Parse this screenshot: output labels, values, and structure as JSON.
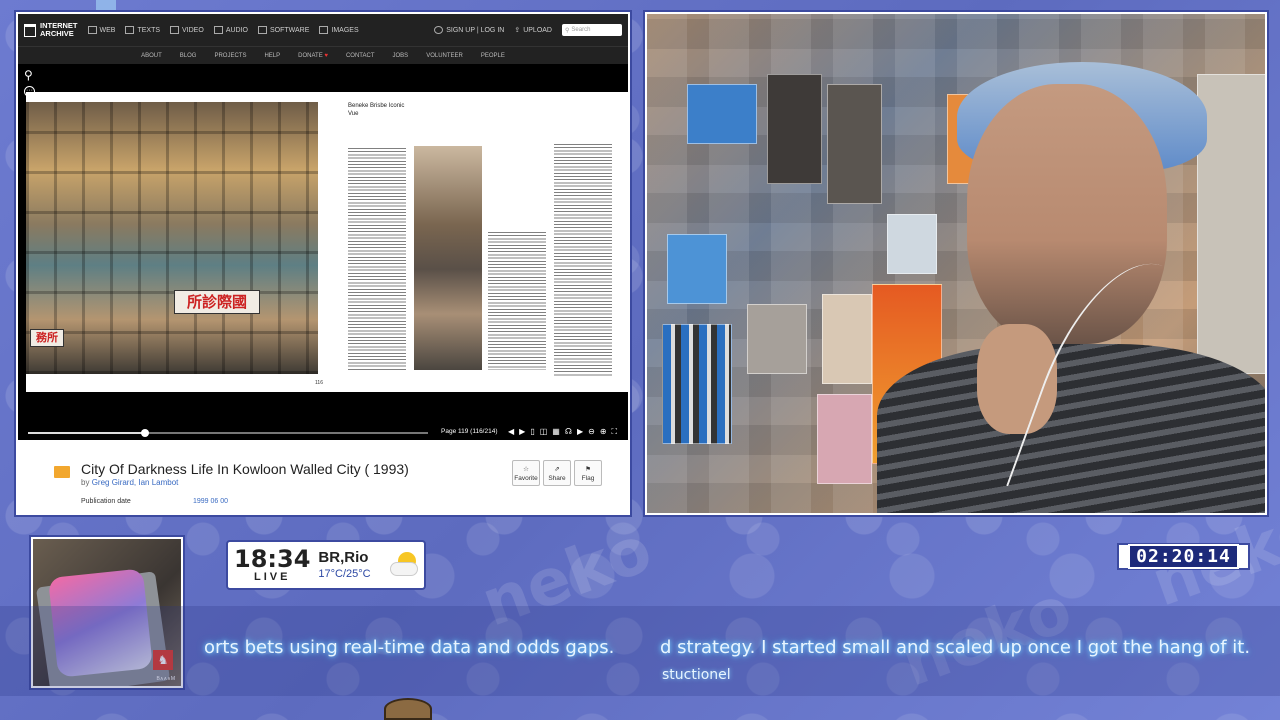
{
  "browser": {
    "logo_line1": "INTERNET",
    "logo_line2": "ARCHIVE",
    "nav": [
      "WEB",
      "TEXTS",
      "VIDEO",
      "AUDIO",
      "SOFTWARE",
      "IMAGES"
    ],
    "signin": "SIGN UP | LOG IN",
    "upload": "UPLOAD",
    "search_placeholder": "Search",
    "subnav": [
      "ABOUT",
      "BLOG",
      "PROJECTS",
      "HELP",
      "DONATE",
      "CONTACT",
      "JOBS",
      "VOLUNTEER",
      "PEOPLE"
    ],
    "donate_symbol": "♥"
  },
  "reader": {
    "page_indicator": "Page 119 (116/214)",
    "progress_fraction": 0.53,
    "sign_main": "所診際國",
    "sign_small": "務所",
    "page_number": "116",
    "right_title": "Beneke Brisbe Iconic Vue"
  },
  "item": {
    "title": "City Of Darkness Life In Kowloon Walled City ( 1993)",
    "by_prefix": "by",
    "authors": "Greg Girard, Ian Lambot",
    "favorite": "Favorite",
    "share": "Share",
    "flag": "Flag",
    "pub_label": "Publication date",
    "pub_value": "1999 06 00"
  },
  "overlay": {
    "time": "18:34",
    "live": "LIVE",
    "location": "BR,Rio",
    "temps": "17°C/25°C",
    "timer": "02:20:14",
    "caption_left": "orts bets using real-time data and odds gaps.",
    "caption_right": "d strategy. I started small and scaled up once I got the hang of it.",
    "caption_sub": "stuctionel",
    "thumb_label": "B∧∧∧M",
    "bg_word": "neko"
  },
  "colors": {
    "accent": "#3c4aa0",
    "background": "#6a78c8",
    "caption_glow": "#7fd7ff",
    "ia_bar": "#222222"
  }
}
